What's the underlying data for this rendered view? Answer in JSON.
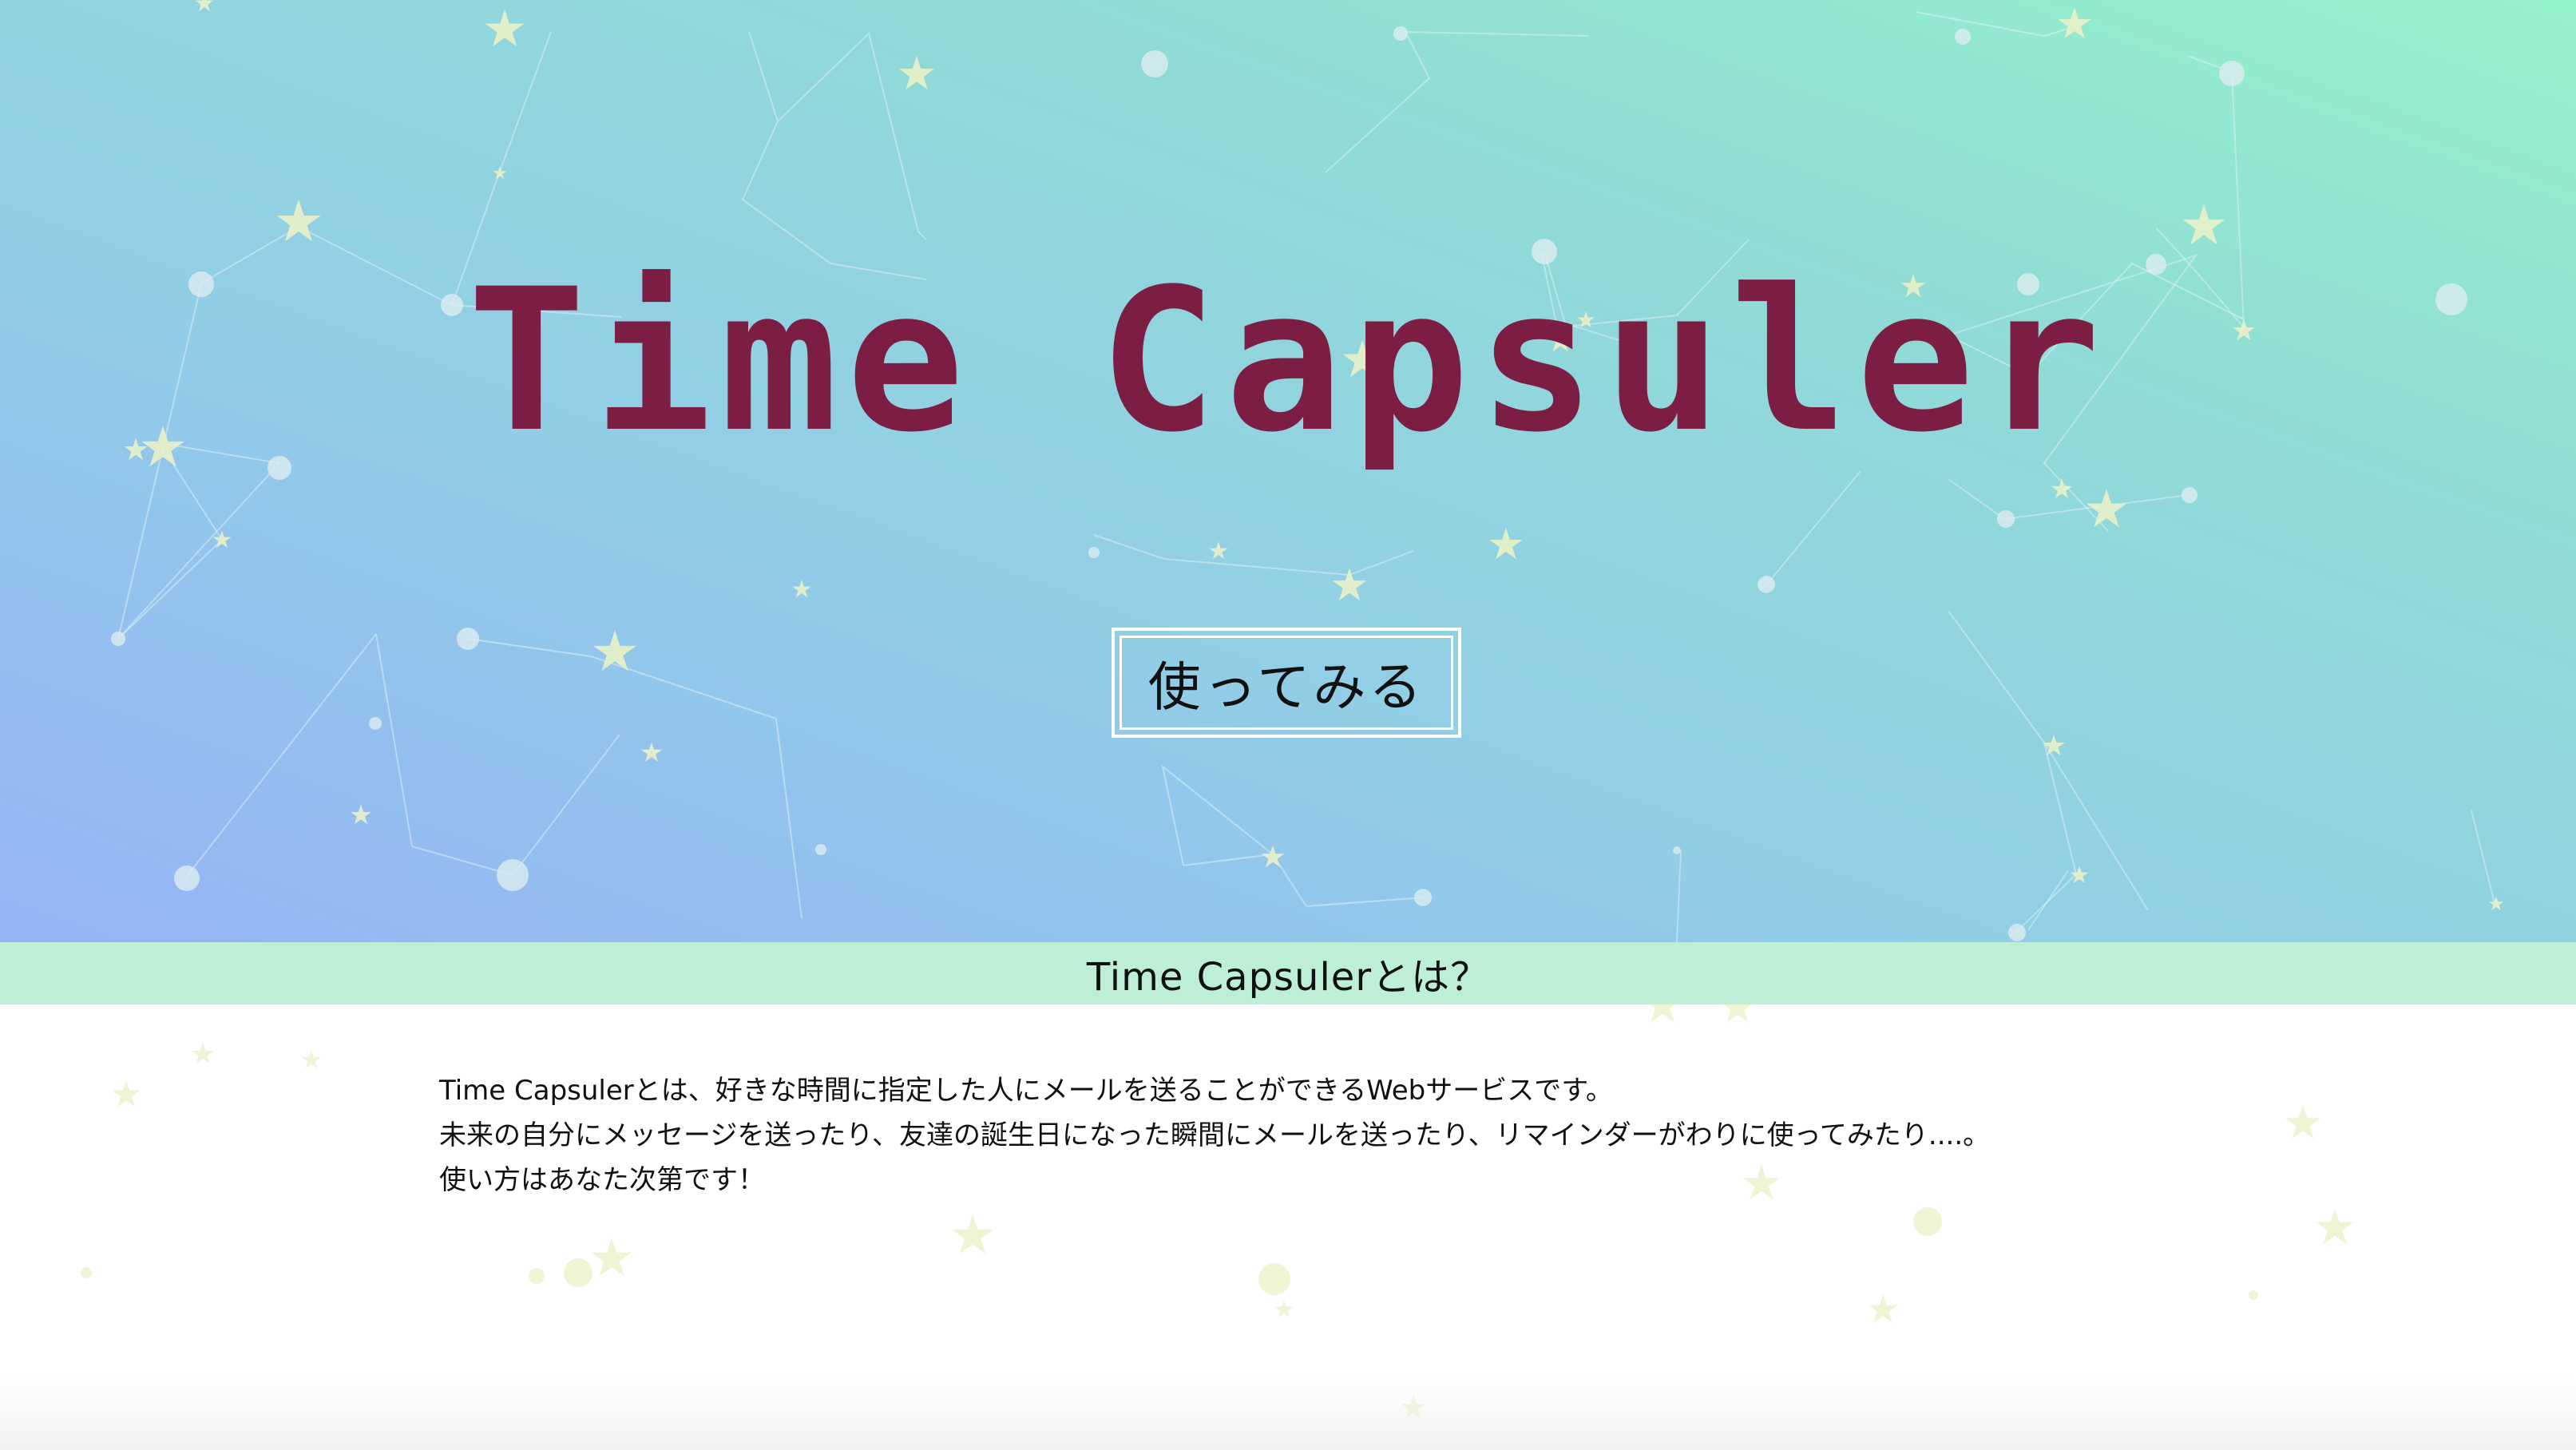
{
  "hero": {
    "title": "Time Capsuler",
    "cta_label": "使ってみる"
  },
  "about": {
    "heading": "Time Capsulerとは？",
    "lines": [
      "Time Capsulerとは、好きな時間に指定した人にメールを送ることができるWebサービスです。",
      "未来の自分にメッセージを送ったり、友達の誕生日になった瞬間にメールを送ったり、リマインダーがわりに使ってみたり....。",
      "使い方はあなた次第です！"
    ]
  },
  "colors": {
    "title": "#7c1d44",
    "section_bar": "#bdeed6",
    "gradient_left": "#94b4f6",
    "gradient_right": "#94f2cb",
    "star": "#eaf2c6"
  }
}
